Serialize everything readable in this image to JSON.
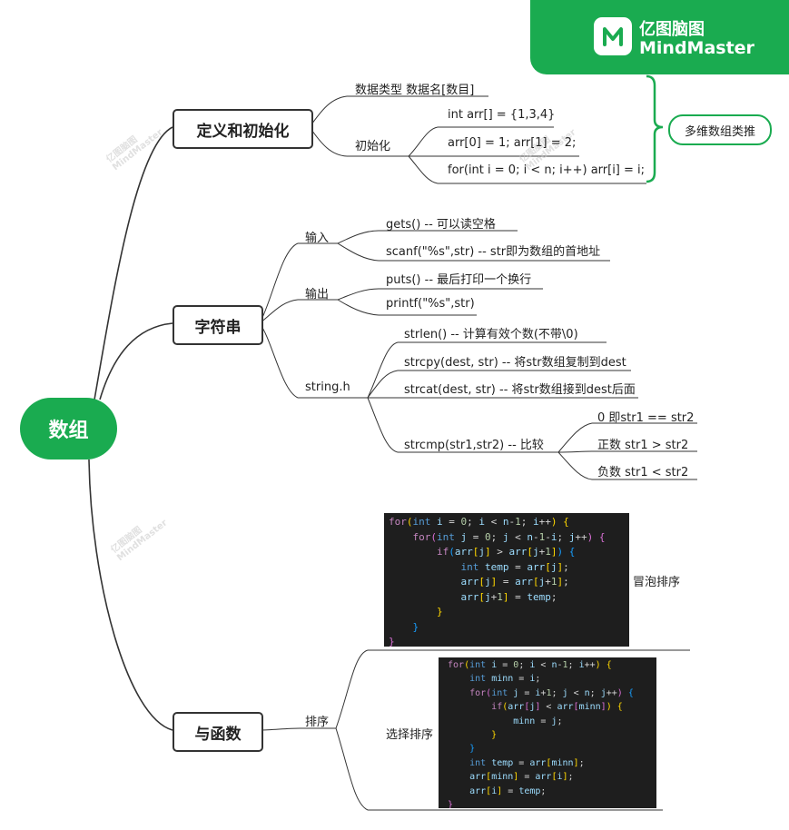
{
  "brand": {
    "name_cn": "亿图脑图",
    "name_en": "MindMaster",
    "icon": "mindmaster-logo-icon"
  },
  "watermark": {
    "cn": "亿图脑图",
    "en": "MindMaster"
  },
  "root": {
    "label": "数组"
  },
  "branches": [
    {
      "label": "定义和初始化",
      "children": [
        {
          "label": "数据类型 数据名[数目]"
        },
        {
          "label": "初始化",
          "children": [
            {
              "label": "int arr[] = {1,3,4}"
            },
            {
              "label": "arr[0] = 1; arr[1] = 2;"
            },
            {
              "label": "for(int i = 0; i < n; i++) arr[i] = i;"
            }
          ]
        }
      ],
      "callout": "多维数组类推"
    },
    {
      "label": "字符串",
      "children": [
        {
          "label": "输入",
          "children": [
            {
              "label": "gets() -- 可以读空格"
            },
            {
              "label": "scanf(\"%s\",str) -- str即为数组的首地址"
            }
          ]
        },
        {
          "label": "输出",
          "children": [
            {
              "label": "puts() -- 最后打印一个换行"
            },
            {
              "label": "printf(\"%s\",str)"
            }
          ]
        },
        {
          "label": "string.h",
          "children": [
            {
              "label": "strlen() -- 计算有效个数(不带\\0)"
            },
            {
              "label": "strcpy(dest, str) -- 将str数组复制到dest"
            },
            {
              "label": "strcat(dest, str) -- 将str数组接到dest后面"
            },
            {
              "label": "strcmp(str1,str2) -- 比较",
              "children": [
                {
                  "label": "0 即str1 == str2"
                },
                {
                  "label": "正数 str1 > str2"
                },
                {
                  "label": "负数 str1 < str2"
                }
              ]
            }
          ]
        }
      ]
    },
    {
      "label": "与函数",
      "children": [
        {
          "label": "排序",
          "children": [
            {
              "label": "冒泡排序"
            },
            {
              "label": "选择排序"
            }
          ]
        }
      ]
    }
  ],
  "code_bubble": [
    "for(int i = 0; i < n-1; i++) {",
    "    for(int j = 0; j < n-1-i; j++) {",
    "        if(arr[j] > arr[j+1]) {",
    "            int temp = arr[j];",
    "            arr[j] = arr[j+1];",
    "            arr[j+1] = temp;",
    "        }",
    "    }",
    "}"
  ],
  "code_selection": [
    "for(int i = 0; i < n-1; i++) {",
    "    int minn = i;",
    "    for(int j = i+1; j < n; j++) {",
    "        if(arr[j] < arr[minn]) {",
    "            minn = j;",
    "        }",
    "    }",
    "    int temp = arr[minn];",
    "    arr[minn] = arr[i];",
    "    arr[i] = temp;",
    "}"
  ]
}
